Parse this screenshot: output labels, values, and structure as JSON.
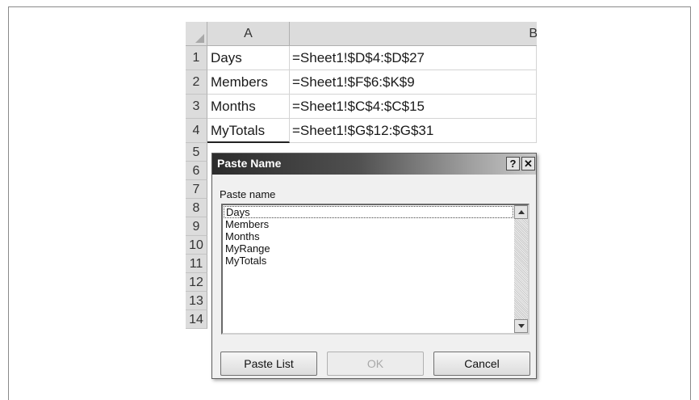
{
  "spreadsheet": {
    "columns": [
      "A",
      "B"
    ],
    "rows": [
      {
        "num": "1",
        "a": "Days",
        "b": "=Sheet1!$D$4:$D$27"
      },
      {
        "num": "2",
        "a": "Members",
        "b": "=Sheet1!$F$6:$K$9"
      },
      {
        "num": "3",
        "a": "Months",
        "b": "=Sheet1!$C$4:$C$15"
      },
      {
        "num": "4",
        "a": "MyTotals",
        "b": "=Sheet1!$G$12:$G$31"
      },
      {
        "num": "5"
      },
      {
        "num": "6"
      },
      {
        "num": "7"
      },
      {
        "num": "8"
      },
      {
        "num": "9"
      },
      {
        "num": "10"
      },
      {
        "num": "11"
      },
      {
        "num": "12"
      },
      {
        "num": "13"
      },
      {
        "num": "14"
      }
    ]
  },
  "dialog": {
    "title": "Paste Name",
    "help_label": "?",
    "close_label": "✕",
    "list_label": "Paste name",
    "names": [
      "Days",
      "Members",
      "Months",
      "MyRange",
      "MyTotals"
    ],
    "paste_list_label": "Paste List",
    "ok_label": "OK",
    "cancel_label": "Cancel"
  },
  "colors": {
    "titlebar_start": "#2c2c2c",
    "titlebar_end": "#c8c8c8"
  }
}
